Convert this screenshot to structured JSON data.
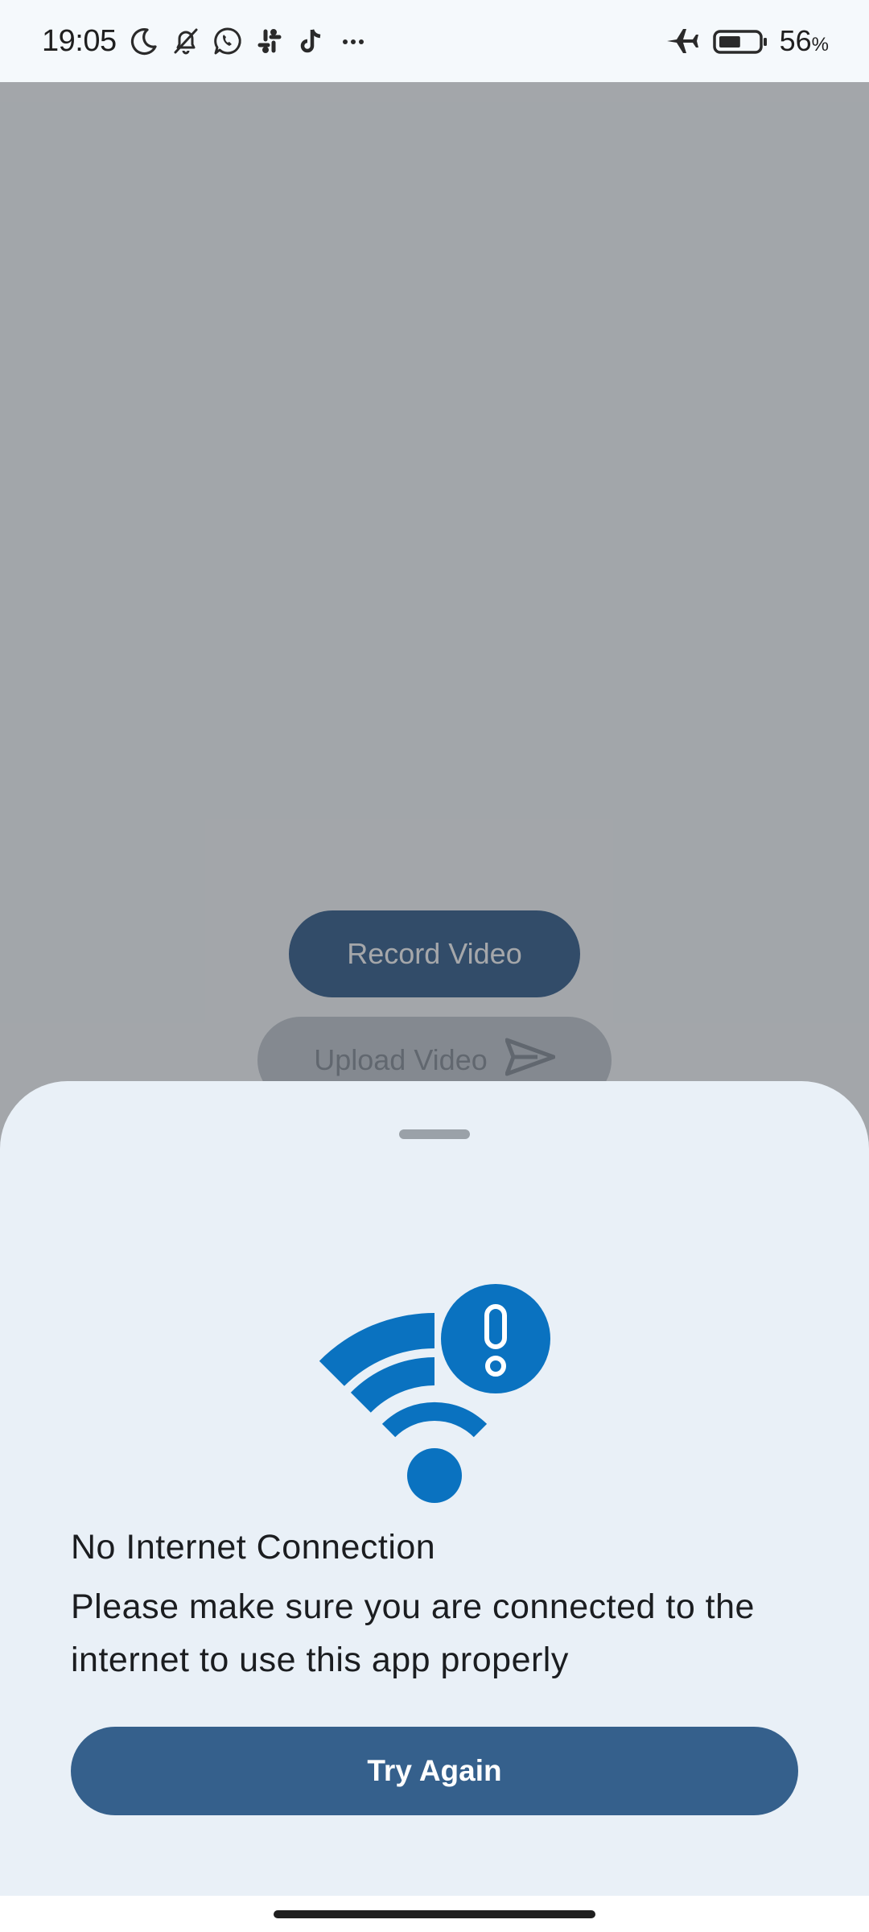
{
  "status_bar": {
    "time": "19:05",
    "battery_percent": "56",
    "battery_unit": "%",
    "battery_level": 0.56,
    "notification_icons": [
      "moon-icon",
      "bell-off-icon",
      "whatsapp-icon",
      "slack-icon",
      "tiktok-icon",
      "more-dots-icon"
    ],
    "right_icons": [
      "airplane-mode-icon",
      "battery-icon"
    ]
  },
  "background_app": {
    "record_button_label": "Record Video",
    "upload_button_label": "Upload Video",
    "upload_button_icon": "send-icon"
  },
  "sheet": {
    "illustration_icon": "wifi-alert-icon",
    "title": "No Internet Connection",
    "message": "Please make sure you are connected to the internet to use this app properly",
    "primary_button_label": "Try Again"
  },
  "colors": {
    "accent": "#0a72c0",
    "primary_button": "#35608c",
    "sheet_background": "#e9f0f7"
  }
}
